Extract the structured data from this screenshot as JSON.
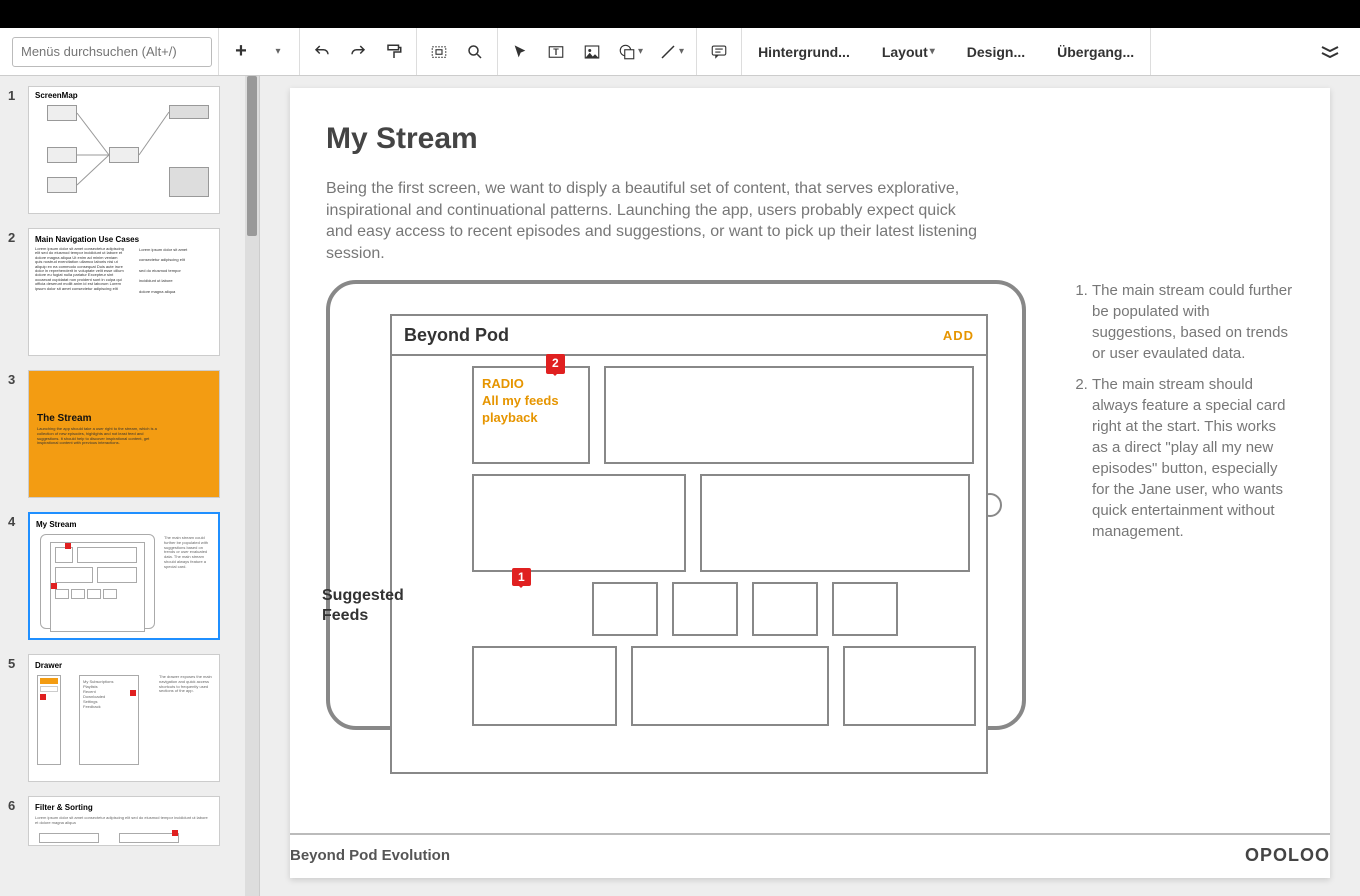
{
  "toolbar": {
    "search_placeholder": "Menüs durchsuchen (Alt+/)",
    "background": "Hintergrund...",
    "layout": "Layout",
    "design": "Design...",
    "transition": "Übergang..."
  },
  "thumbnails": {
    "t1": {
      "title": "ScreenMap"
    },
    "t2": {
      "title": "Main Navigation Use Cases"
    },
    "t3": {
      "title": "The Stream"
    },
    "t4": {
      "title": "My Stream"
    },
    "t5": {
      "title": "Drawer"
    },
    "t6": {
      "title": "Filter & Sorting"
    }
  },
  "slide": {
    "title": "My Stream",
    "body": "Being the first screen, we want to disply a beautiful set of content, that serves explorative, inspirational and continuational patterns. Launching the app, users probably expect quick and easy access to recent episodes and suggestions, or want to pick up their latest listening session.",
    "app_title": "Beyond Pod",
    "add_label": "ADD",
    "radio_card_line1": "RADIO",
    "radio_card_line2": "All my feeds playback",
    "suggested_label": "Suggested Feeds",
    "callout1": "1",
    "callout2": "2",
    "annotation1": "The main stream could further be populated with suggestions, based on trends or user evaulated data.",
    "annotation2": "The main stream should always feature a special card right at the start. This works as a direct \"play all my new episodes\"  button, especially for the Jane user, who wants quick entertainment without management.",
    "footer_left": "Beyond Pod Evolution",
    "footer_right": "OPOLOO"
  }
}
